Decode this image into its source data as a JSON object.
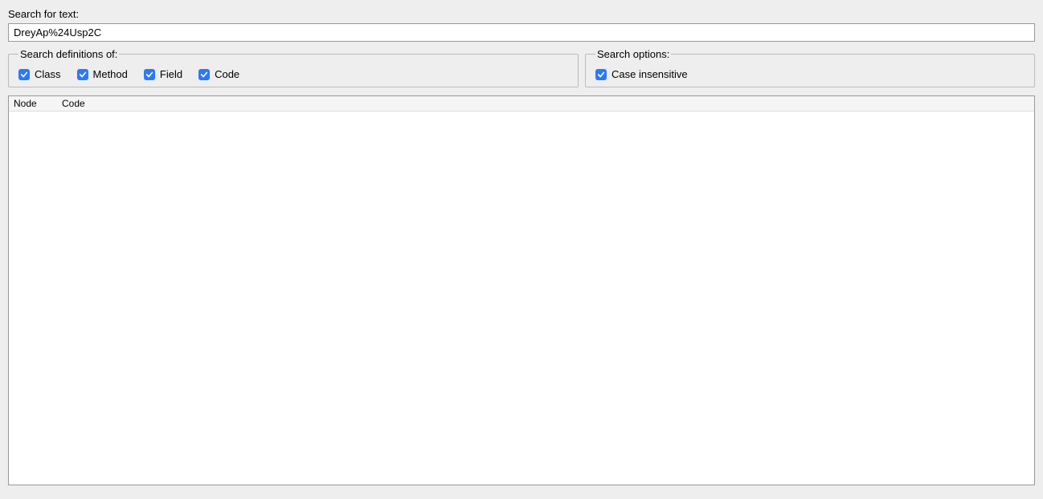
{
  "search": {
    "label": "Search for text:",
    "value": "DreyAp%24Usp2C"
  },
  "definitions": {
    "legend": "Search definitions of:",
    "class": {
      "label": "Class",
      "checked": true
    },
    "method": {
      "label": "Method",
      "checked": true
    },
    "field": {
      "label": "Field",
      "checked": true
    },
    "code": {
      "label": "Code",
      "checked": true
    }
  },
  "options": {
    "legend": "Search options:",
    "caseInsensitive": {
      "label": "Case insensitive",
      "checked": true
    }
  },
  "results": {
    "columns": {
      "node": "Node",
      "code": "Code"
    },
    "rows": []
  }
}
